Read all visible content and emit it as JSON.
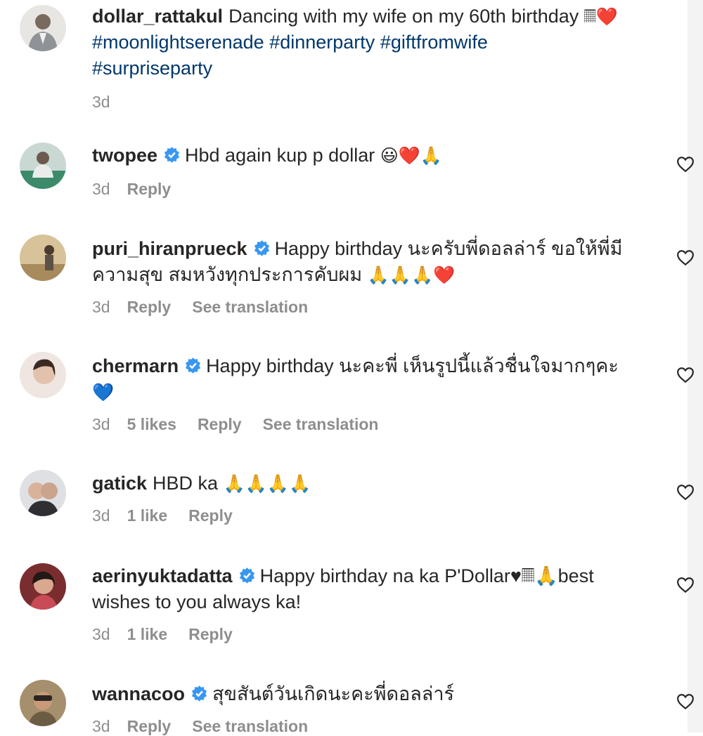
{
  "caption": {
    "username": "dollar_rattakul",
    "text": "Dancing with my wife on my 60th birthday",
    "emoji": "𝄜❤️",
    "hashtags": [
      "#moonlightserenade",
      "#dinnerparty",
      "#giftfromwife",
      "#surpriseparty"
    ],
    "time": "3d"
  },
  "comments": [
    {
      "username": "twopee",
      "verified": true,
      "text": "Hbd again kup p dollar",
      "emoji": "😃❤️🙏",
      "time": "3d",
      "likes": "",
      "reply": "Reply",
      "translate": ""
    },
    {
      "username": "puri_hiranprueck",
      "verified": true,
      "text": "Happy birthday นะครับพี่ดอลล่าร์ ขอให้พี่มีความสุข สมหวังทุกประการคับผม",
      "emoji": "🙏🙏🙏❤️",
      "time": "3d",
      "likes": "",
      "reply": "Reply",
      "translate": "See translation"
    },
    {
      "username": "chermarn",
      "verified": true,
      "text": "Happy birthday นะคะพี่ เห็นรูปนี้แล้วชื่นใจมากๆคะ",
      "emoji": "💙",
      "time": "3d",
      "likes": "5 likes",
      "reply": "Reply",
      "translate": "See translation"
    },
    {
      "username": "gatick",
      "verified": false,
      "text": "HBD ka",
      "emoji": "🙏🙏🙏🙏",
      "time": "3d",
      "likes": "1 like",
      "reply": "Reply",
      "translate": ""
    },
    {
      "username": "aerinyuktadatta",
      "verified": true,
      "text": "Happy birthday na ka P'Dollar♥𝄜🙏best wishes to you always ka!",
      "emoji": "",
      "time": "3d",
      "likes": "1 like",
      "reply": "Reply",
      "translate": ""
    },
    {
      "username": "wannacoo",
      "verified": true,
      "text": "สุขสันต์วันเกิดนะคะพี่ดอลล่าร์",
      "emoji": "",
      "time": "3d",
      "likes": "",
      "reply": "Reply",
      "translate": "See translation"
    }
  ],
  "colors": {
    "text": "#262626",
    "meta": "#8e8e8e",
    "hashtag": "#00376b",
    "verified": "#3897f0"
  },
  "icons": {
    "like": "heart-outline-icon",
    "verified": "verified-badge-icon"
  }
}
